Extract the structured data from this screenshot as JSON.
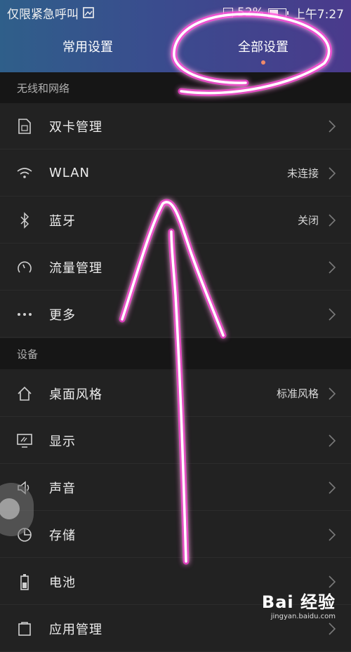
{
  "status_bar": {
    "carrier_text": "仅限紧急呼叫",
    "battery_percent": "52%",
    "battery_level": 0.52,
    "time": "上午7:27",
    "icons": [
      "image-notification-icon",
      "sim-card-icon",
      "battery-icon"
    ]
  },
  "tabs": [
    {
      "label": "常用设置",
      "active": false
    },
    {
      "label": "全部设置",
      "active": true
    }
  ],
  "sections": [
    {
      "title": "无线和网络",
      "items": [
        {
          "label": "双卡管理",
          "value": "",
          "icon": "sim-card-icon"
        },
        {
          "label": "WLAN",
          "value": "未连接",
          "icon": "wifi-icon"
        },
        {
          "label": "蓝牙",
          "value": "关闭",
          "icon": "bluetooth-icon"
        },
        {
          "label": "流量管理",
          "value": "",
          "icon": "data-usage-icon"
        },
        {
          "label": "更多",
          "value": "",
          "icon": "more-icon"
        }
      ]
    },
    {
      "title": "设备",
      "items": [
        {
          "label": "桌面风格",
          "value": "标准风格",
          "icon": "home-icon"
        },
        {
          "label": "显示",
          "value": "",
          "icon": "display-icon"
        },
        {
          "label": "声音",
          "value": "",
          "icon": "speaker-icon"
        },
        {
          "label": "存储",
          "value": "",
          "icon": "storage-icon"
        },
        {
          "label": "电池",
          "value": "",
          "icon": "battery-icon"
        },
        {
          "label": "应用管理",
          "value": "",
          "icon": "apps-icon"
        }
      ]
    }
  ],
  "watermark": {
    "brand": "Bai 经验",
    "url": "jingyan.baidu.com"
  },
  "colors": {
    "annotation": "#ff2bd6",
    "tab_indicator": "#f08a6a"
  }
}
